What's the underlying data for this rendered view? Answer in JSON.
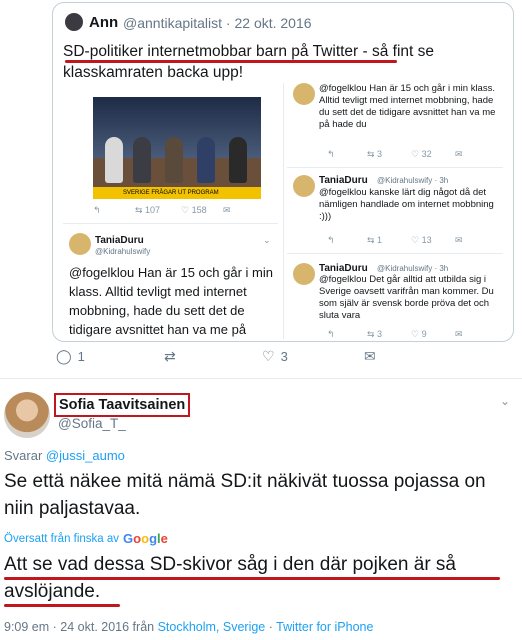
{
  "quoted_tweet": {
    "name": "Ann",
    "handle": "@anntikapitalist · 22 okt. 2016",
    "text": "SD-politiker internetmobbar barn på Twitter - så fint se klasskamraten backa upp!",
    "embedded_screenshot": {
      "tv_banner": "SVERIGE FRÅGAR UT PROGRAM",
      "left_actions": {
        "retweets": "107",
        "likes": "158"
      },
      "left_reply": {
        "name": "TaniaDuru",
        "handle": "@Kidrahulswify",
        "text": "@fogelklou Han är 15 och går i min klass. Alltid tevligt med internet mobbning, hade du sett det de tidigare avsnittet han va me på"
      },
      "right_top": {
        "text": "@fogelklou Han är 15 och går i min klass. Alltid tevligt med internet mobbning, hade du sett det de tidigare avsnittet han va me på hade du",
        "retweets": "3",
        "likes": "32"
      },
      "right_mid": {
        "name": "TaniaDuru",
        "handle": "@Kidrahulswify · 3h",
        "text": "@fogelklou kanske lärt dig något då det nämligen handlade om internet mobbning :)))",
        "retweets": "1",
        "likes": "13"
      },
      "right_bottom": {
        "name": "TaniaDuru",
        "handle": "@Kidrahulswify · 3h",
        "text": "@fogelklou Det går alltid att utbilda sig i Sverige oavsett varifrån man kommer. Du som själv är svensk borde pröva det och sluta vara",
        "retweets": "3",
        "likes": "9"
      }
    },
    "actions": {
      "replies": "1",
      "retweets": "3"
    }
  },
  "tweet": {
    "name": "Sofia Taavitsainen",
    "handle": "@Sofia_T_",
    "replying_prefix": "Svarar",
    "replying_to": "@jussi_aumo",
    "text": "Se että näkee mitä nämä SD:it näkivät tuossa pojassa on niin paljastavaa.",
    "translated_label": "Översatt från finska av",
    "translated_provider": "Google",
    "translation": "Att se vad dessa SD-skivor såg i den där pojken är så avslöjande.",
    "meta_time": "9:09 em · 24 okt. 2016 från",
    "meta_location": "Stockholm, Sverige",
    "meta_sep": "·",
    "meta_client": "Twitter for iPhone"
  },
  "colors": {
    "accent": "#1da1f2",
    "annotation_red": "#c0161d",
    "secondary_text": "#657786"
  }
}
